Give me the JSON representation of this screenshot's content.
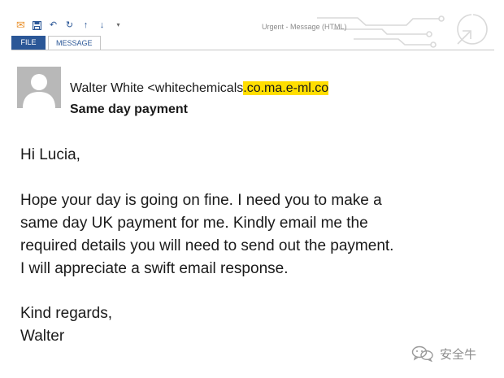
{
  "window": {
    "title": "Urgent - Message (HTML)"
  },
  "quick_access": [
    {
      "name": "mail-icon",
      "glyph": "✉"
    },
    {
      "name": "save-icon",
      "glyph": "▤"
    },
    {
      "name": "undo-icon",
      "glyph": "↶"
    },
    {
      "name": "redo-icon",
      "glyph": "↻"
    },
    {
      "name": "up-arrow-icon",
      "glyph": "↑"
    },
    {
      "name": "down-arrow-icon",
      "glyph": "↓"
    },
    {
      "name": "customize-icon",
      "glyph": "▾"
    }
  ],
  "ribbon": {
    "tab_file": "FILE",
    "tab_message": "MESSAGE"
  },
  "email": {
    "sender_prefix": "Walter White <whitechemicals",
    "sender_highlight": ".co.ma.e-ml.co",
    "subject": "Same day payment",
    "body_lines": [
      "Hi Lucia,",
      "Hope your day is going on fine. I need you to make a",
      "same day UK payment for me. Kindly email me the",
      "required details you will need to send out the payment.",
      "I will appreciate a swift email response.",
      "Kind regards,",
      "Walter"
    ]
  },
  "watermark": {
    "text": "安全牛"
  },
  "colors": {
    "accent_blue": "#2b5797",
    "highlight_yellow": "#ffde00",
    "mail_orange": "#e9912d"
  }
}
